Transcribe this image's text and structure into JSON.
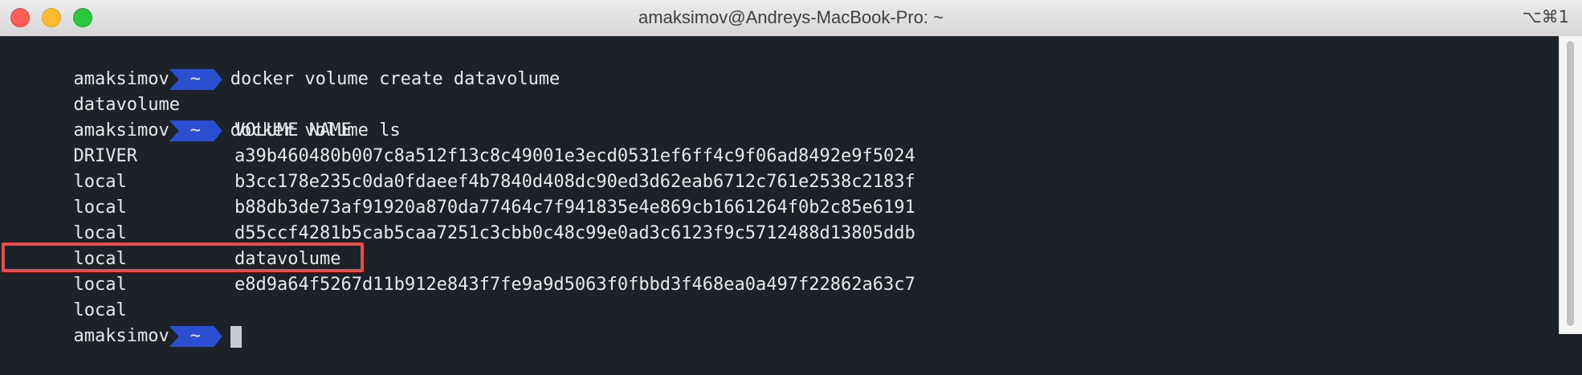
{
  "window": {
    "title": "amaksimov@Andreys-MacBook-Pro: ~",
    "shortcut": "⌥⌘1"
  },
  "prompt": {
    "user": "amaksimov",
    "dir": "~"
  },
  "lines": {
    "cmd1": "docker volume create datavolume",
    "out1": "datavolume",
    "cmd2": "docker volume ls",
    "header": {
      "driver": "DRIVER",
      "volume_name": "VOLUME NAME"
    },
    "rows": [
      {
        "driver": "local",
        "name": "a39b460480b007c8a512f13c8c49001e3ecd0531ef6ff4c9f06ad8492e9f5024"
      },
      {
        "driver": "local",
        "name": "b3cc178e235c0da0fdaeef4b7840d408dc90ed3d62eab6712c761e2538c2183f"
      },
      {
        "driver": "local",
        "name": "b88db3de73af91920a870da77464c7f941835e4e869cb1661264f0b2c85e6191"
      },
      {
        "driver": "local",
        "name": "d55ccf4281b5cab5caa7251c3cbb0c48c99e0ad3c6123f9c5712488d13805ddb"
      },
      {
        "driver": "local",
        "name": "datavolume"
      },
      {
        "driver": "local",
        "name": "e8d9a64f5267d11b912e843f7fe9a9d5063f0fbbd3f468ea0a497f22862a63c7"
      }
    ]
  },
  "colors": {
    "terminal_bg": "#1d2229",
    "prompt_segment": "#2b4fd1",
    "highlight_border": "#ea4b4b"
  }
}
